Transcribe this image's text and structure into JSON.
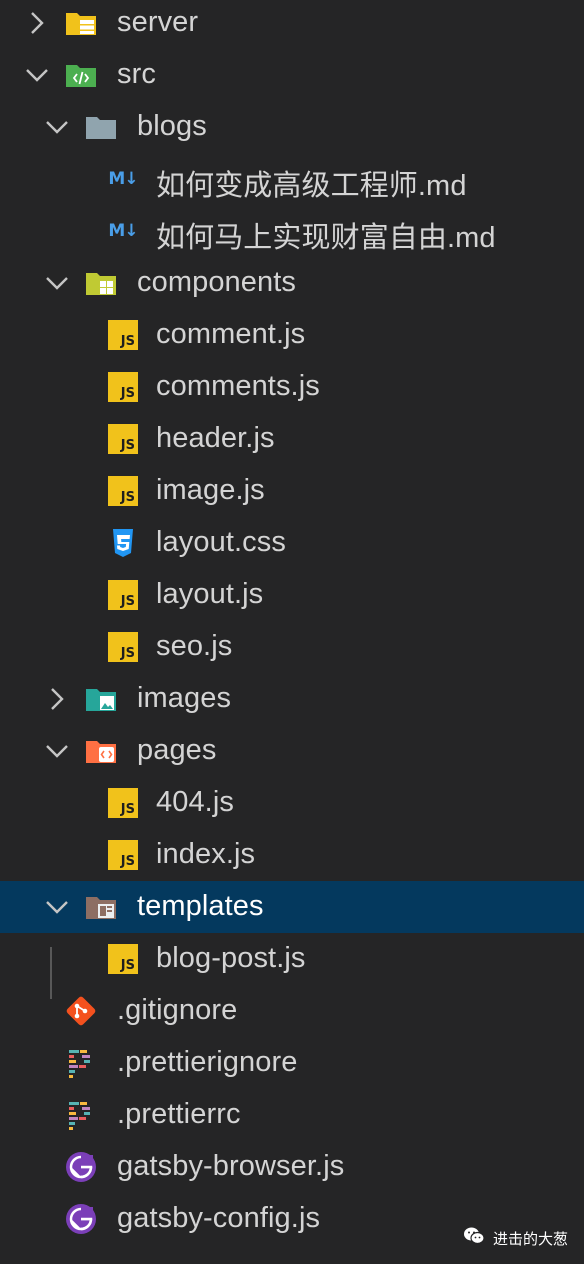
{
  "tree": [
    {
      "label": "server",
      "type": "folder",
      "expanded": false,
      "depth": 0,
      "icon": "server-folder-icon",
      "color": "#f1c21b"
    },
    {
      "label": "src",
      "type": "folder",
      "expanded": true,
      "depth": 0,
      "icon": "src-folder-icon",
      "color": "#4caf50"
    },
    {
      "label": "blogs",
      "type": "folder",
      "expanded": true,
      "depth": 1,
      "icon": "folder-icon",
      "color": "#90a4ae"
    },
    {
      "label": "如何变成高级工程师.md",
      "type": "file",
      "depth": 2,
      "icon": "markdown-icon"
    },
    {
      "label": "如何马上实现财富自由.md",
      "type": "file",
      "depth": 2,
      "icon": "markdown-icon"
    },
    {
      "label": "components",
      "type": "folder",
      "expanded": true,
      "depth": 1,
      "icon": "components-folder-icon",
      "color": "#c0ca33"
    },
    {
      "label": "comment.js",
      "type": "file",
      "depth": 2,
      "icon": "js-file-icon"
    },
    {
      "label": "comments.js",
      "type": "file",
      "depth": 2,
      "icon": "js-file-icon"
    },
    {
      "label": "header.js",
      "type": "file",
      "depth": 2,
      "icon": "js-file-icon"
    },
    {
      "label": "image.js",
      "type": "file",
      "depth": 2,
      "icon": "js-file-icon"
    },
    {
      "label": "layout.css",
      "type": "file",
      "depth": 2,
      "icon": "css-file-icon"
    },
    {
      "label": "layout.js",
      "type": "file",
      "depth": 2,
      "icon": "js-file-icon"
    },
    {
      "label": "seo.js",
      "type": "file",
      "depth": 2,
      "icon": "js-file-icon"
    },
    {
      "label": "images",
      "type": "folder",
      "expanded": false,
      "depth": 1,
      "icon": "images-folder-icon",
      "color": "#26a69a"
    },
    {
      "label": "pages",
      "type": "folder",
      "expanded": true,
      "depth": 1,
      "icon": "pages-folder-icon",
      "color": "#ff7043"
    },
    {
      "label": "404.js",
      "type": "file",
      "depth": 2,
      "icon": "js-file-icon"
    },
    {
      "label": "index.js",
      "type": "file",
      "depth": 2,
      "icon": "js-file-icon"
    },
    {
      "label": "templates",
      "type": "folder",
      "expanded": true,
      "depth": 1,
      "icon": "templates-folder-icon",
      "color": "#8d6e63",
      "selected": true
    },
    {
      "label": "blog-post.js",
      "type": "file",
      "depth": 2,
      "icon": "js-file-icon"
    },
    {
      "label": ".gitignore",
      "type": "file",
      "depth": 1,
      "icon": "git-icon"
    },
    {
      "label": ".prettierignore",
      "type": "file",
      "depth": 1,
      "icon": "prettier-icon"
    },
    {
      "label": ".prettierrc",
      "type": "file",
      "depth": 1,
      "icon": "prettier-icon"
    },
    {
      "label": "gatsby-browser.js",
      "type": "file",
      "depth": 1,
      "icon": "gatsby-icon"
    },
    {
      "label": "gatsby-config.js",
      "type": "file",
      "depth": 1,
      "icon": "gatsby-icon"
    }
  ],
  "watermark": {
    "text": "进击的大葱",
    "icon": "wechat-icon"
  },
  "colors": {
    "background": "#252526",
    "selection": "#04395e",
    "text": "#d4d4d4",
    "js": "#f1c21b",
    "markdown": "#4a9ee8",
    "css": "#2196f3",
    "git": "#f4511e",
    "gatsby": "#7b3fb8"
  }
}
